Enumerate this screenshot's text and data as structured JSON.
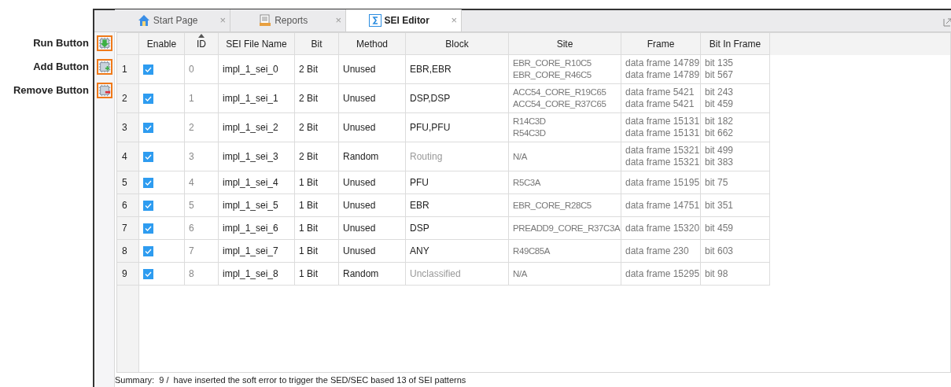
{
  "tool_buttons": [
    {
      "label": "Run Button",
      "kind": "run"
    },
    {
      "label": "Add Button",
      "kind": "add"
    },
    {
      "label": "Remove Button",
      "kind": "remove"
    }
  ],
  "tabs": [
    {
      "label": "Start Page",
      "kind": "home",
      "selected": false,
      "close": "×"
    },
    {
      "label": "Reports",
      "kind": "report",
      "selected": false,
      "close": "×"
    },
    {
      "label": "SEI Editor",
      "kind": "sei",
      "selected": true,
      "close": "×"
    }
  ],
  "table": {
    "columns": [
      {
        "label": "Enable",
        "sorted": false
      },
      {
        "label": "ID",
        "sorted": true
      },
      {
        "label": "SEI File Name",
        "sorted": false
      },
      {
        "label": "Bit",
        "sorted": false
      },
      {
        "label": "Method",
        "sorted": false
      },
      {
        "label": "Block",
        "sorted": false
      },
      {
        "label": "Site",
        "sorted": false
      },
      {
        "label": "Frame",
        "sorted": false
      },
      {
        "label": "Bit In Frame",
        "sorted": false
      }
    ],
    "rows": [
      {
        "row": "1",
        "enable": true,
        "id": "0",
        "file": "impl_1_sei_0",
        "bit": "2 Bit",
        "method": "Unused",
        "block": "EBR,EBR",
        "block_muted": false,
        "sites": [
          "EBR_CORE_R10C5",
          "EBR_CORE_R46C5"
        ],
        "frames": [
          "data frame 14789",
          "data frame 14789"
        ],
        "bits": [
          "bit 135",
          "bit 567"
        ]
      },
      {
        "row": "2",
        "enable": true,
        "id": "1",
        "file": "impl_1_sei_1",
        "bit": "2 Bit",
        "method": "Unused",
        "block": "DSP,DSP",
        "block_muted": false,
        "sites": [
          "ACC54_CORE_R19C65",
          "ACC54_CORE_R37C65"
        ],
        "frames": [
          "data frame 5421",
          "data frame 5421"
        ],
        "bits": [
          "bit 243",
          "bit 459"
        ]
      },
      {
        "row": "3",
        "enable": true,
        "id": "2",
        "file": "impl_1_sei_2",
        "bit": "2 Bit",
        "method": "Unused",
        "block": "PFU,PFU",
        "block_muted": false,
        "sites": [
          "R14C3D",
          "R54C3D"
        ],
        "frames": [
          "data frame 15131",
          "data frame 15131"
        ],
        "bits": [
          "bit 182",
          "bit 662"
        ]
      },
      {
        "row": "4",
        "enable": true,
        "id": "3",
        "file": "impl_1_sei_3",
        "bit": "2 Bit",
        "method": "Random",
        "block": "Routing",
        "block_muted": true,
        "sites": [
          "N/A"
        ],
        "frames": [
          "data frame 15321",
          "data frame 15321"
        ],
        "bits": [
          "bit 499",
          "bit 383"
        ]
      },
      {
        "row": "5",
        "enable": true,
        "id": "4",
        "file": "impl_1_sei_4",
        "bit": "1 Bit",
        "method": "Unused",
        "block": "PFU",
        "block_muted": false,
        "sites": [
          "R5C3A"
        ],
        "frames": [
          "data frame 15195"
        ],
        "bits": [
          "bit 75"
        ]
      },
      {
        "row": "6",
        "enable": true,
        "id": "5",
        "file": "impl_1_sei_5",
        "bit": "1 Bit",
        "method": "Unused",
        "block": "EBR",
        "block_muted": false,
        "sites": [
          "EBR_CORE_R28C5"
        ],
        "frames": [
          "data frame 14751"
        ],
        "bits": [
          "bit 351"
        ]
      },
      {
        "row": "7",
        "enable": true,
        "id": "6",
        "file": "impl_1_sei_6",
        "bit": "1 Bit",
        "method": "Unused",
        "block": "DSP",
        "block_muted": false,
        "sites": [
          "PREADD9_CORE_R37C3A"
        ],
        "frames": [
          "data frame 15320"
        ],
        "bits": [
          "bit 459"
        ]
      },
      {
        "row": "8",
        "enable": true,
        "id": "7",
        "file": "impl_1_sei_7",
        "bit": "1 Bit",
        "method": "Unused",
        "block": "ANY",
        "block_muted": false,
        "sites": [
          "R49C85A"
        ],
        "frames": [
          "data frame 230"
        ],
        "bits": [
          "bit 603"
        ]
      },
      {
        "row": "9",
        "enable": true,
        "id": "8",
        "file": "impl_1_sei_8",
        "bit": "1 Bit",
        "method": "Random",
        "block": "Unclassified",
        "block_muted": true,
        "sites": [
          "N/A"
        ],
        "frames": [
          "data frame 15295"
        ],
        "bits": [
          "bit 98"
        ]
      }
    ]
  },
  "summary": "Summary:  9 /  have inserted the soft error to trigger the SED/SEC based 13 of SEI patterns"
}
